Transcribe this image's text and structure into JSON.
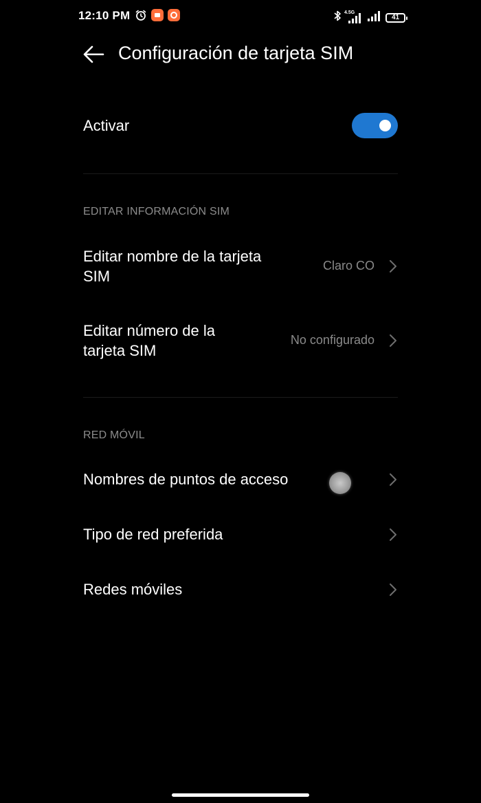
{
  "status_bar": {
    "time": "12:10 PM",
    "network_label": "4.5G",
    "battery_level": "41",
    "icons": [
      "alarm-icon",
      "app-notification-icon",
      "app-notification-icon",
      "bluetooth-icon",
      "signal-icon",
      "signal-icon",
      "battery-icon"
    ]
  },
  "header": {
    "title": "Configuración de tarjeta SIM",
    "back_icon": "arrow-left-icon"
  },
  "activate": {
    "label": "Activar",
    "enabled": true,
    "toggle_color": "#1f78d1"
  },
  "sim_info_section": {
    "heading": "EDITAR INFORMACIÓN SIM",
    "items": [
      {
        "label_line1": "Editar nombre de la tarjeta",
        "label_line2": "SIM",
        "value": "Claro CO"
      },
      {
        "label_line1": "Editar número de la",
        "label_line2": "tarjeta SIM",
        "value": "No configurado"
      }
    ]
  },
  "mobile_network_section": {
    "heading": "RED MÓVIL",
    "items": [
      {
        "label": "Nombres de puntos de acceso"
      },
      {
        "label": "Tipo de red preferida"
      },
      {
        "label": "Redes móviles"
      }
    ]
  },
  "colors": {
    "background": "#000000",
    "text_primary": "#ffffff",
    "text_secondary": "#8a8a8a",
    "accent": "#1f78d1"
  }
}
